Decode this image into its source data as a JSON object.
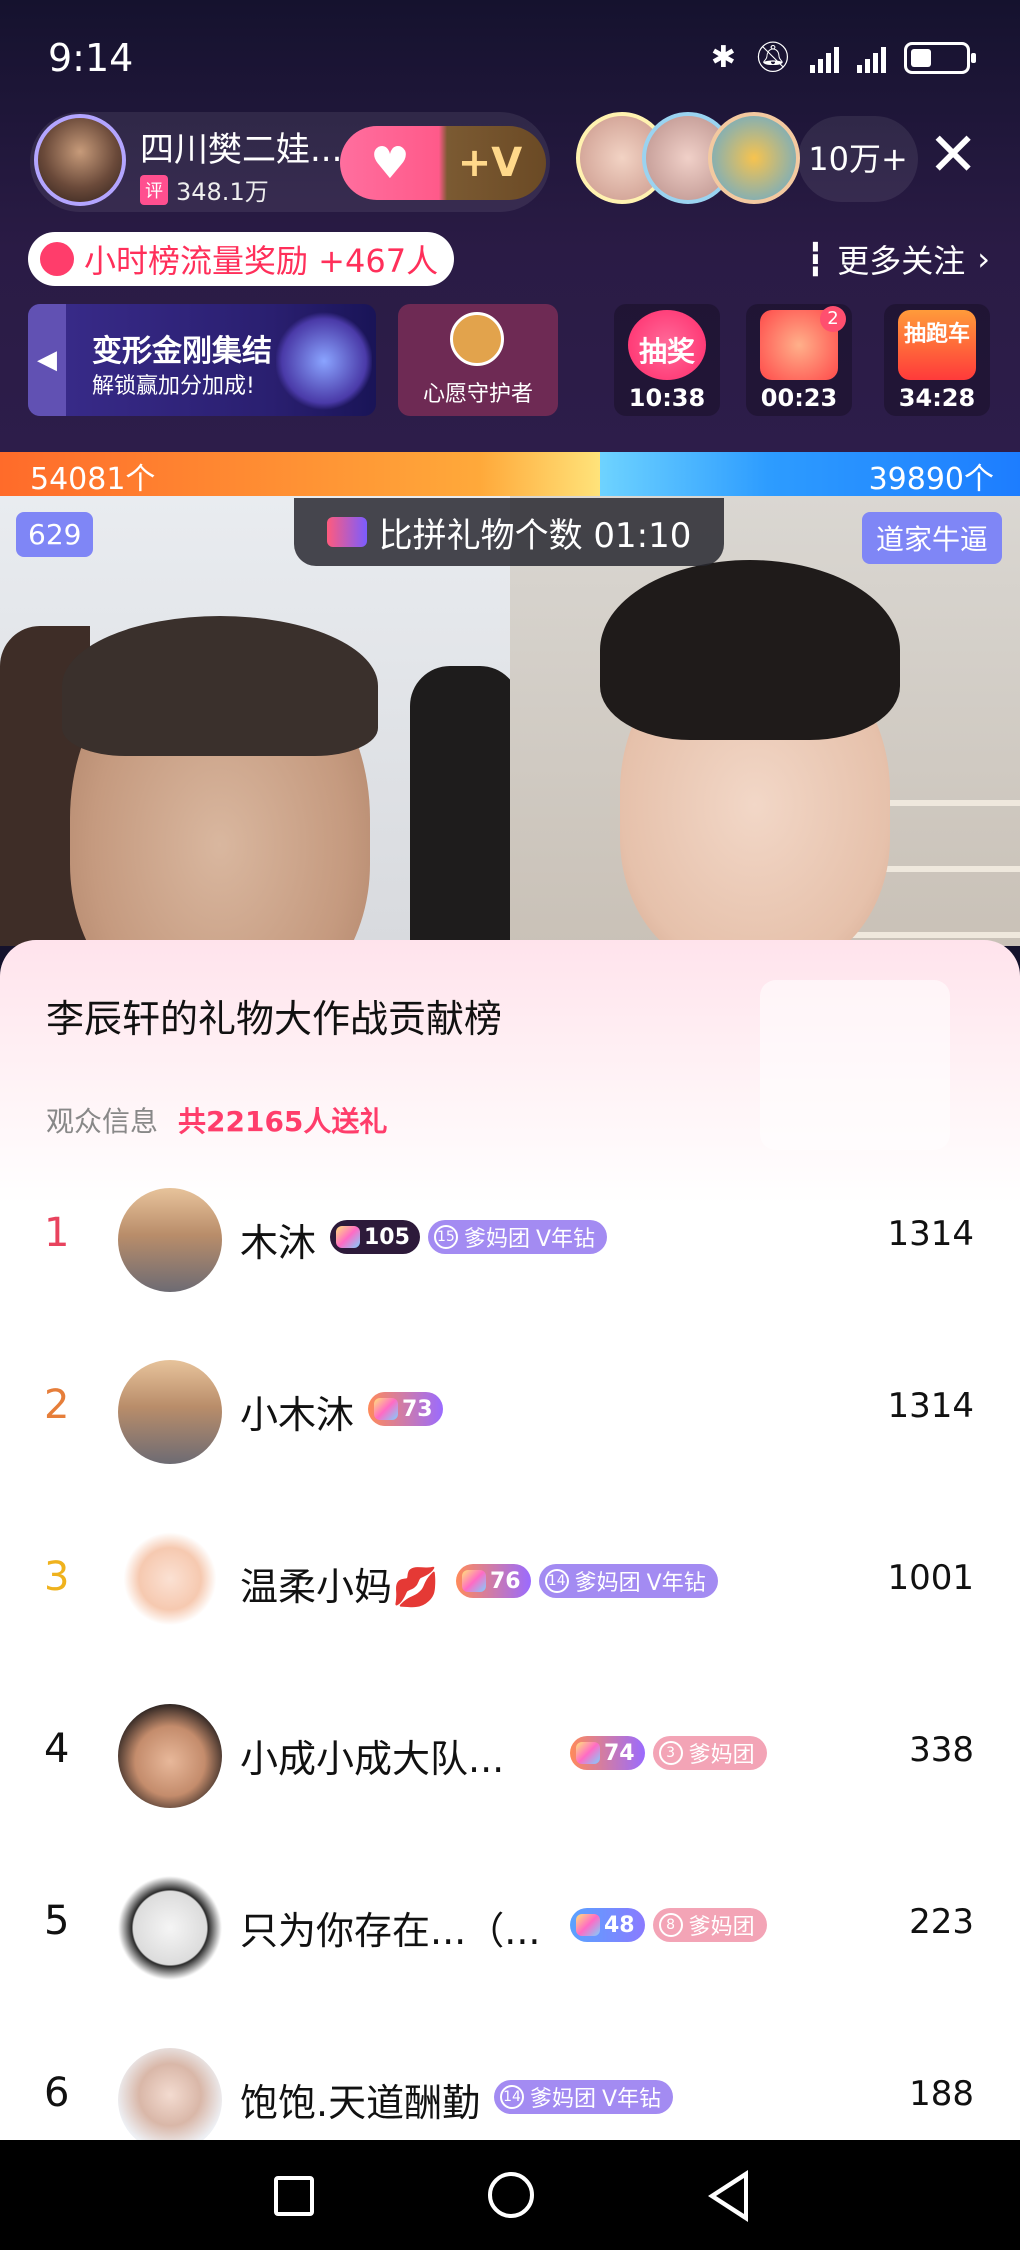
{
  "status_bar": {
    "time": "9:14"
  },
  "streamer": {
    "name": "四川樊二娃...",
    "score_badge": "评",
    "score": "348.1万",
    "follow_heart": "♥",
    "follow_plusv": "+V"
  },
  "viewers": {
    "count": "10万+"
  },
  "reward": {
    "text": "小时榜流量奖励 +467人"
  },
  "more_follow": {
    "label": "更多关注"
  },
  "promo": {
    "title": "变形金刚集结",
    "subtitle": "解锁赢加分加成!"
  },
  "wish_guard": {
    "label": "心愿守护者"
  },
  "timers": [
    {
      "name": "抽奖",
      "time": "10:38",
      "color": "#ff3a7a"
    },
    {
      "name": "",
      "time": "00:23",
      "badge": "2",
      "color": "#ff5b5b"
    },
    {
      "name": "抽跑车",
      "time": "34:28",
      "color": "#ff6b3a"
    }
  ],
  "pk": {
    "left_count": "54081个",
    "right_count": "39890个",
    "title": "比拼礼物个数 01:10",
    "left_tag": "629",
    "right_tag": "道家牛逼"
  },
  "panel": {
    "title": "李辰轩的礼物大作战贡献榜",
    "audience_label": "观众信息",
    "audience_count": "共22165人送礼"
  },
  "rankings": [
    {
      "rank": "1",
      "name": "木沐",
      "level": "105",
      "fan_level": "15",
      "fan_label": "爹妈团",
      "vip": "V年钻",
      "score": "1314"
    },
    {
      "rank": "2",
      "name": "小木沐",
      "level": "73",
      "score": "1314"
    },
    {
      "rank": "3",
      "name": "温柔小妈💋",
      "level": "76",
      "fan_level": "14",
      "fan_label": "爹妈团",
      "vip": "V年钻",
      "score": "1001"
    },
    {
      "rank": "4",
      "name": "小成小成大队...",
      "level": "74",
      "fan_level": "3",
      "fan_label": "爹妈团",
      "score": "338"
    },
    {
      "rank": "5",
      "name": "只为你存在...（...",
      "level": "48",
      "fan_level": "8",
      "fan_label": "爹妈团",
      "score": "223"
    },
    {
      "rank": "6",
      "name": "饱饱.天道酬勤",
      "fan_level": "14",
      "fan_label": "爹妈团",
      "vip": "V年钻",
      "score": "188"
    }
  ],
  "colors": {
    "rank1": "#e8435e",
    "rank2": "#e67e3a",
    "rank3": "#efb21d",
    "accent": "#ff3d6b"
  }
}
